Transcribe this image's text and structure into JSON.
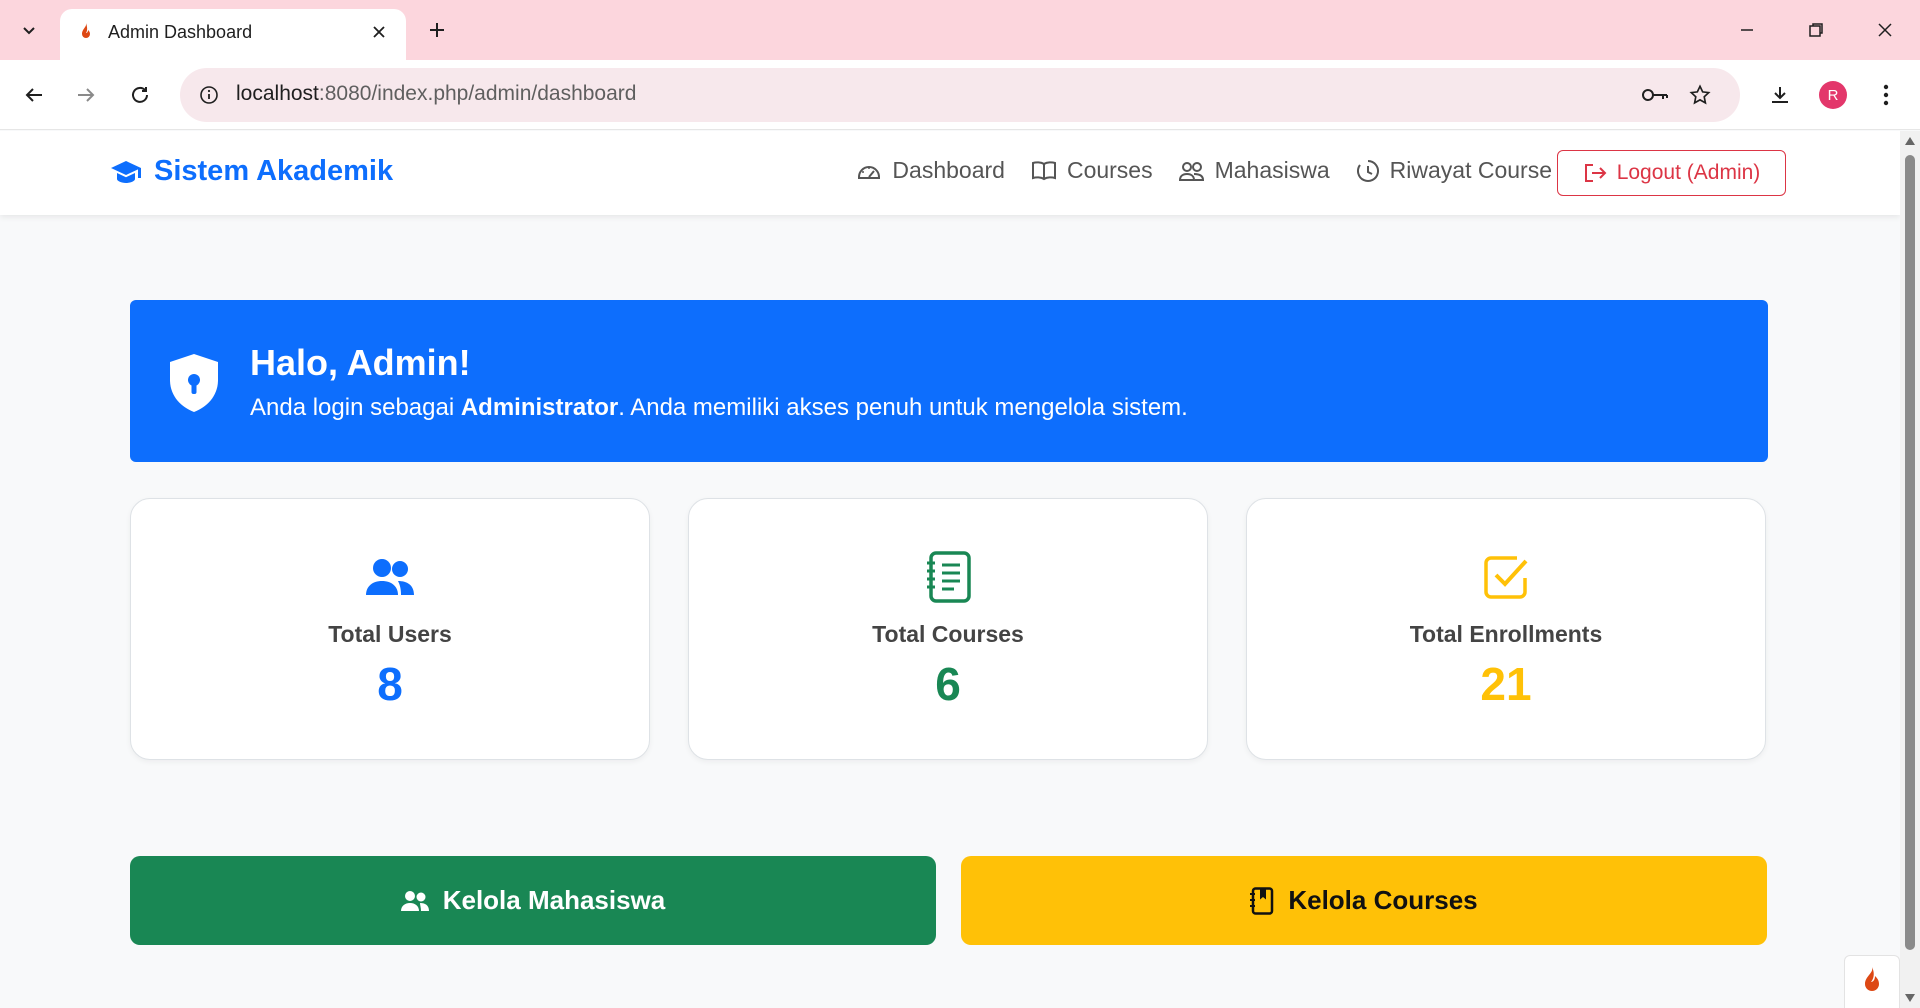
{
  "browser": {
    "tab_title": "Admin Dashboard",
    "url_host": "localhost",
    "url_rest": ":8080/index.php/admin/dashboard",
    "profile_initial": "R"
  },
  "navbar": {
    "brand": "Sistem Akademik",
    "links": [
      "Dashboard",
      "Courses",
      "Mahasiswa",
      "Riwayat Course"
    ],
    "logout_label": "Logout (Admin)"
  },
  "welcome": {
    "title": "Halo, Admin!",
    "text_before": "Anda login sebagai ",
    "text_bold": "Administrator",
    "text_after": ". Anda memiliki akses penuh untuk mengelola sistem."
  },
  "stats": [
    {
      "label": "Total Users",
      "value": "8",
      "icon": "users-icon",
      "color": "#0d6efd"
    },
    {
      "label": "Total Courses",
      "value": "6",
      "icon": "journal-icon",
      "color": "#198754"
    },
    {
      "label": "Total Enrollments",
      "value": "21",
      "icon": "check-square-icon",
      "color": "#ffc107"
    }
  ],
  "actions": {
    "manage_students": "Kelola Mahasiswa",
    "manage_courses": "Kelola Courses"
  },
  "colors": {
    "primary": "#0d6efd",
    "success": "#198754",
    "warning": "#ffc107",
    "danger": "#dc3545",
    "tabbar": "#fcd6dd"
  }
}
